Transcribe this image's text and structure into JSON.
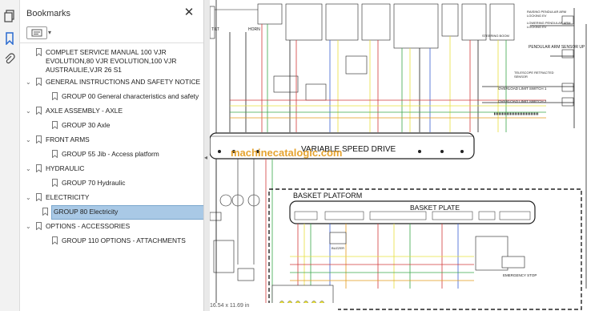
{
  "panel": {
    "title": "Bookmarks",
    "items": [
      {
        "label_lines": [
          "COMPLET SERVICE MANUAL   100 VJR",
          "EVOLUTION,80 VJR EVOLUTION,100 VJR",
          "AUSTRAULIE,VJR 26 S1"
        ],
        "expander": "none"
      },
      {
        "label": "GENERAL INSTRUCTIONS AND SAFETY NOTICE",
        "expander": "open"
      },
      {
        "label": "GROUP 00 General characteristics and safety",
        "expander": "none"
      },
      {
        "label": "AXLE ASSEMBLY - AXLE",
        "expander": "open"
      },
      {
        "label": "GROUP 30 Axle",
        "expander": "none"
      },
      {
        "label": "FRONT ARMS",
        "expander": "open"
      },
      {
        "label": "GROUP 55 Jib - Access platform",
        "expander": "none"
      },
      {
        "label": "HYDRAULIC",
        "expander": "open"
      },
      {
        "label": "GROUP 70 Hydraulic",
        "expander": "none"
      },
      {
        "label": "ELECTRICITY",
        "expander": "open"
      },
      {
        "label": "GROUP 80 Electricity",
        "expander": "none",
        "selected": true
      },
      {
        "label": "OPTIONS - ACCESSORIES",
        "expander": "open"
      },
      {
        "label": "GROUP 110  OPTIONS - ATTACHMENTS",
        "expander": "none"
      }
    ]
  },
  "rail": {
    "icons": [
      "pages-icon",
      "bookmark-icon",
      "attachment-icon"
    ]
  },
  "document": {
    "labels": {
      "vsd": "VARIABLE SPEED DRIVE",
      "watermark": "machinecatalogic.com",
      "basket_platform": "BASKET PLATFORM",
      "basket_plate": "BASKET PLATE",
      "tilt": "TILT",
      "horn": "HORN",
      "pendular_sensor": "PENDULAR ARM SENSOR UP",
      "raising_pendular": "RAISING PENDULAR ARM LOCKING EV",
      "lowering_pendular": "LOWERING PENDULAR ARM LOCKING EV",
      "overload_1": "OVERLOAD LIMIT SWITCH 1",
      "overload_2": "OVERLOAD LIMIT SWITCH 2",
      "telescope_retracted": "TELESCOPE RETRACTED SENSOR",
      "steering_boom": "STEERING BOOM",
      "emergency_stop": "EMERGENCY STOP",
      "buzzer": "BUZZER"
    },
    "page_size": "16.54 x 11.69 in"
  },
  "colors": {
    "selection": "#a9c9e6",
    "watermark": "#e39a1a",
    "wire_yellow": "#e8e03c",
    "wire_red": "#d23a3a",
    "wire_green": "#3aa64a",
    "wire_blue": "#3a5fd2"
  }
}
